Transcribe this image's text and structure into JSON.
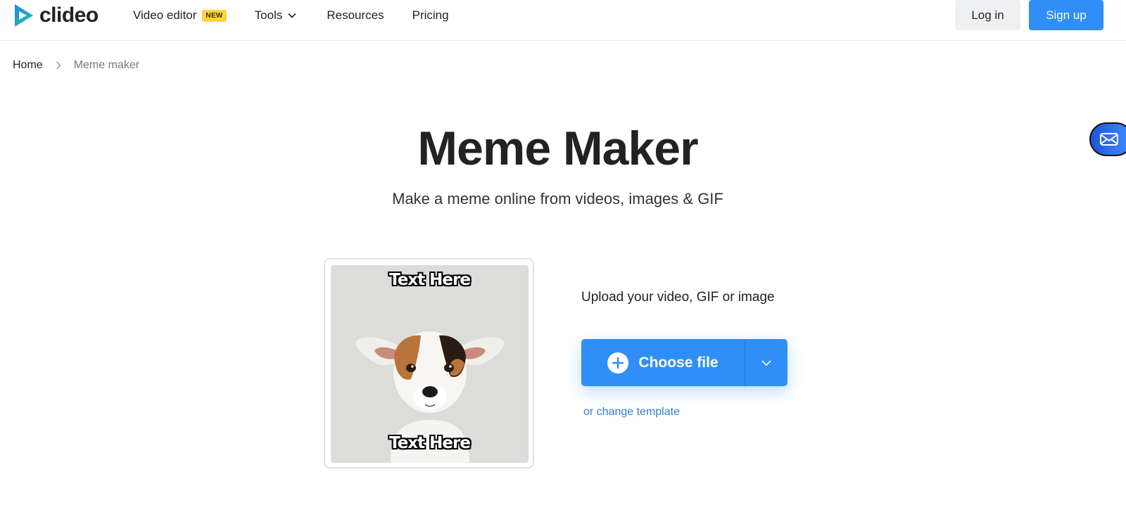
{
  "header": {
    "logo_text": "clideo",
    "nav": {
      "video_editor": "Video editor",
      "new_badge": "NEW",
      "tools": "Tools",
      "resources": "Resources",
      "pricing": "Pricing"
    },
    "login": "Log in",
    "signup": "Sign up"
  },
  "breadcrumb": {
    "home": "Home",
    "current": "Meme maker"
  },
  "hero": {
    "title": "Meme Maker",
    "subtitle": "Make a meme online from videos, images & GIF"
  },
  "template": {
    "top_text": "Text Here",
    "bottom_text": "Text Here"
  },
  "upload": {
    "label": "Upload your video, GIF or image",
    "choose_file": "Choose file",
    "change_template": "or change template"
  },
  "colors": {
    "primary": "#2f8ef7",
    "badge": "#fcd43c",
    "link": "#2f7fd6"
  },
  "icons": [
    "play-logo-icon",
    "chevron-down-icon",
    "chevron-right-icon",
    "plus-icon",
    "mail-icon"
  ]
}
